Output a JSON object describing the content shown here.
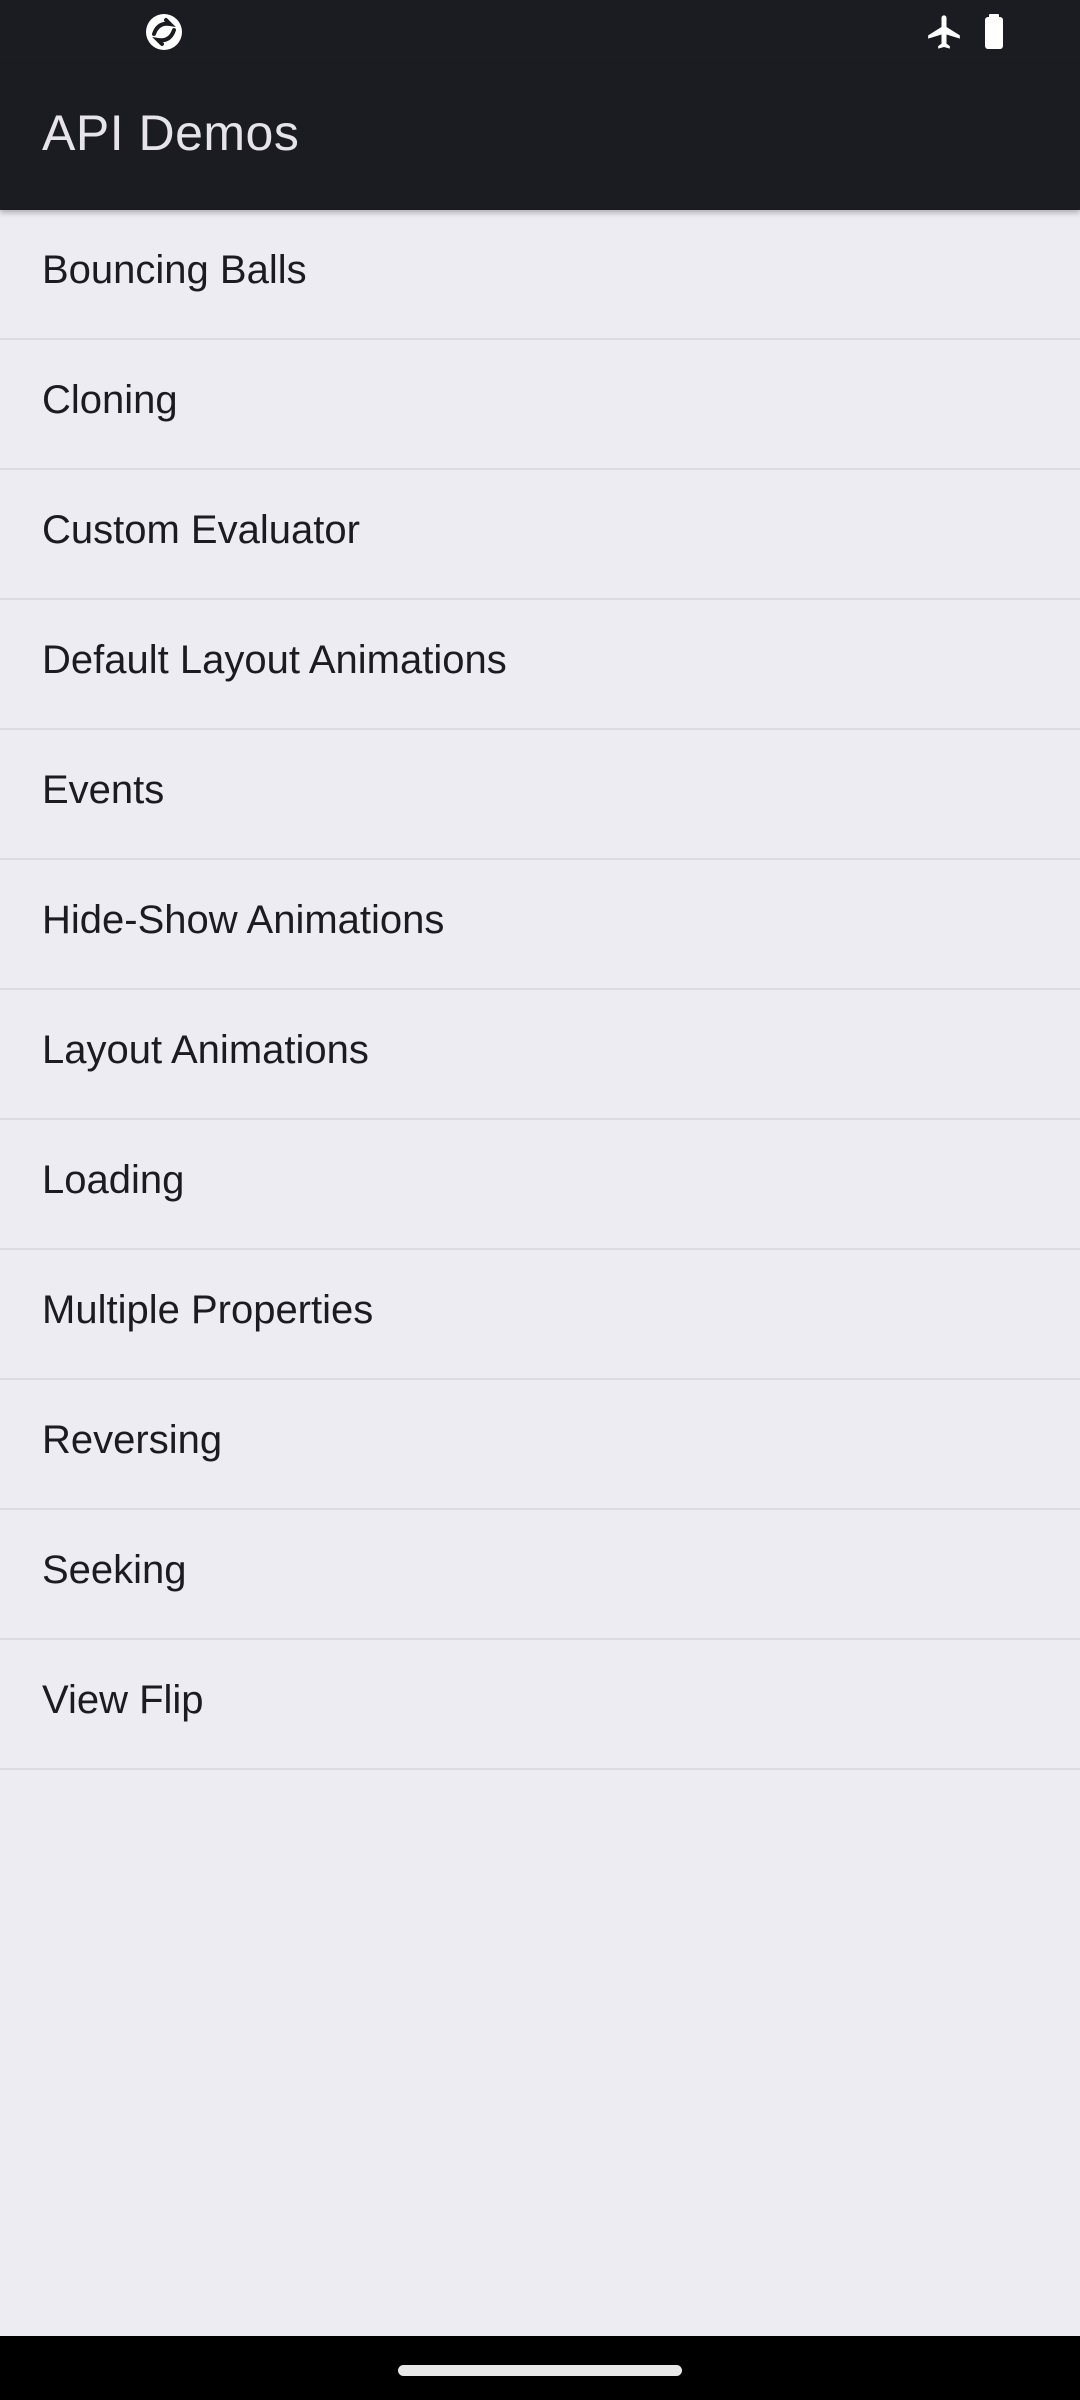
{
  "status_bar": {
    "left_icon": "app-notification-icon",
    "right_icons": [
      "airplane-mode-icon",
      "battery-icon"
    ]
  },
  "app_bar": {
    "title": "API Demos"
  },
  "list": {
    "items": [
      {
        "label": "Bouncing Balls"
      },
      {
        "label": "Cloning"
      },
      {
        "label": "Custom Evaluator"
      },
      {
        "label": "Default Layout Animations"
      },
      {
        "label": "Events"
      },
      {
        "label": "Hide-Show Animations"
      },
      {
        "label": "Layout Animations"
      },
      {
        "label": "Loading"
      },
      {
        "label": "Multiple Properties"
      },
      {
        "label": "Reversing"
      },
      {
        "label": "Seeking"
      },
      {
        "label": "View Flip"
      }
    ]
  },
  "colors": {
    "app_bar_bg": "#1b1c21",
    "background": "#edecf3",
    "divider": "#dcdbe1",
    "text": "#1c1b1f",
    "title_text": "#e6e4ea"
  }
}
